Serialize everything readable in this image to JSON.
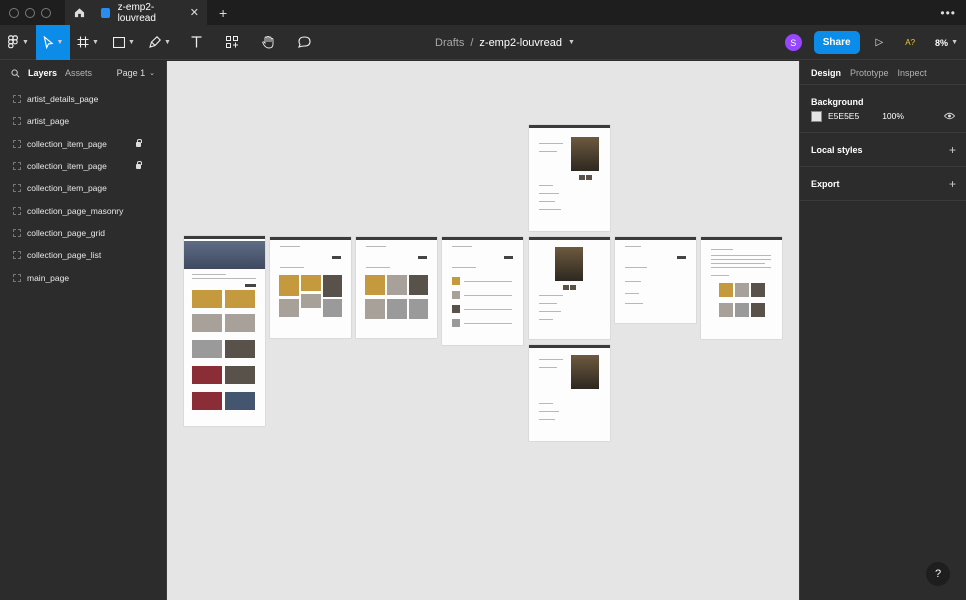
{
  "window": {
    "tab_title": "z-emp2-louvread"
  },
  "toolbar": {
    "breadcrumb_parent": "Drafts",
    "breadcrumb_separator": "/",
    "file_name": "z-emp2-louvread",
    "avatar_initial": "S",
    "share_label": "Share",
    "accessibility_label": "A?",
    "zoom_level": "8%"
  },
  "left_panel": {
    "tab_layers": "Layers",
    "tab_assets": "Assets",
    "page_selector": "Page 1",
    "layers": [
      {
        "name": "artist_details_page",
        "locked": false
      },
      {
        "name": "artist_page",
        "locked": false
      },
      {
        "name": "collection_item_page",
        "locked": true
      },
      {
        "name": "collection_item_page",
        "locked": true
      },
      {
        "name": "collection_item_page",
        "locked": false
      },
      {
        "name": "collection_page_masonry",
        "locked": false
      },
      {
        "name": "collection_page_grid",
        "locked": false
      },
      {
        "name": "collection_page_list",
        "locked": false
      },
      {
        "name": "main_page",
        "locked": false
      }
    ]
  },
  "right_panel": {
    "tab_design": "Design",
    "tab_prototype": "Prototype",
    "tab_inspect": "Inspect",
    "background_title": "Background",
    "background_hex": "E5E5E5",
    "background_opacity": "100%",
    "local_styles_title": "Local styles",
    "export_title": "Export"
  },
  "help_label": "?",
  "colors": {
    "accent": "#0c8ce9",
    "canvas": "#e5e5e5",
    "panel": "#2c2c2c",
    "avatar": "#9747ff"
  }
}
